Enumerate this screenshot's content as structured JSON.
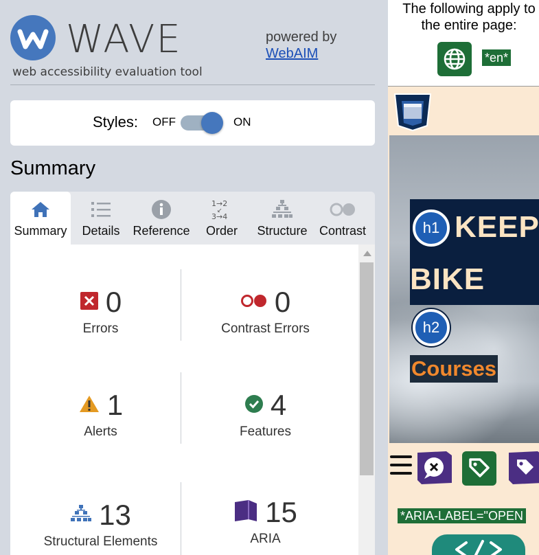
{
  "header": {
    "logo_text": "WAVE",
    "tagline": "web accessibility evaluation tool",
    "powered_by": "powered by",
    "powered_link": "WebAIM"
  },
  "styles_toggle": {
    "label": "Styles:",
    "off": "OFF",
    "on": "ON",
    "state": "on"
  },
  "summary_title": "Summary",
  "tabs": [
    {
      "label": "Summary",
      "icon": "home-icon",
      "active": true
    },
    {
      "label": "Details",
      "icon": "list-icon"
    },
    {
      "label": "Reference",
      "icon": "info-icon"
    },
    {
      "label": "Order",
      "icon": "order-icon"
    },
    {
      "label": "Structure",
      "icon": "structure-icon"
    },
    {
      "label": "Contrast",
      "icon": "contrast-icon"
    }
  ],
  "stats": {
    "errors": {
      "count": "0",
      "label": "Errors"
    },
    "contrast_errors": {
      "count": "0",
      "label": "Contrast Errors"
    },
    "alerts": {
      "count": "1",
      "label": "Alerts"
    },
    "features": {
      "count": "4",
      "label": "Features"
    },
    "structural": {
      "count": "13",
      "label": "Structural Elements"
    },
    "aria": {
      "count": "15",
      "label": "ARIA"
    }
  },
  "preview": {
    "page_info": "The following apply to the entire page:",
    "lang_tag": "*en*",
    "h1_badge": "h1",
    "h1_text_1": "KEEP",
    "h1_text_2": "BIKE",
    "h2_badge": "h2",
    "h2_text": "Courses",
    "aria_label_tag": "*ARIA-LABEL=\"OPEN"
  },
  "colors": {
    "brand_blue": "#4577bd",
    "error_red": "#c0272d",
    "alert_orange": "#e49a22",
    "feature_green": "#2e7d4f",
    "aria_purple": "#4b2e83",
    "tag_green": "#1e6e37"
  }
}
